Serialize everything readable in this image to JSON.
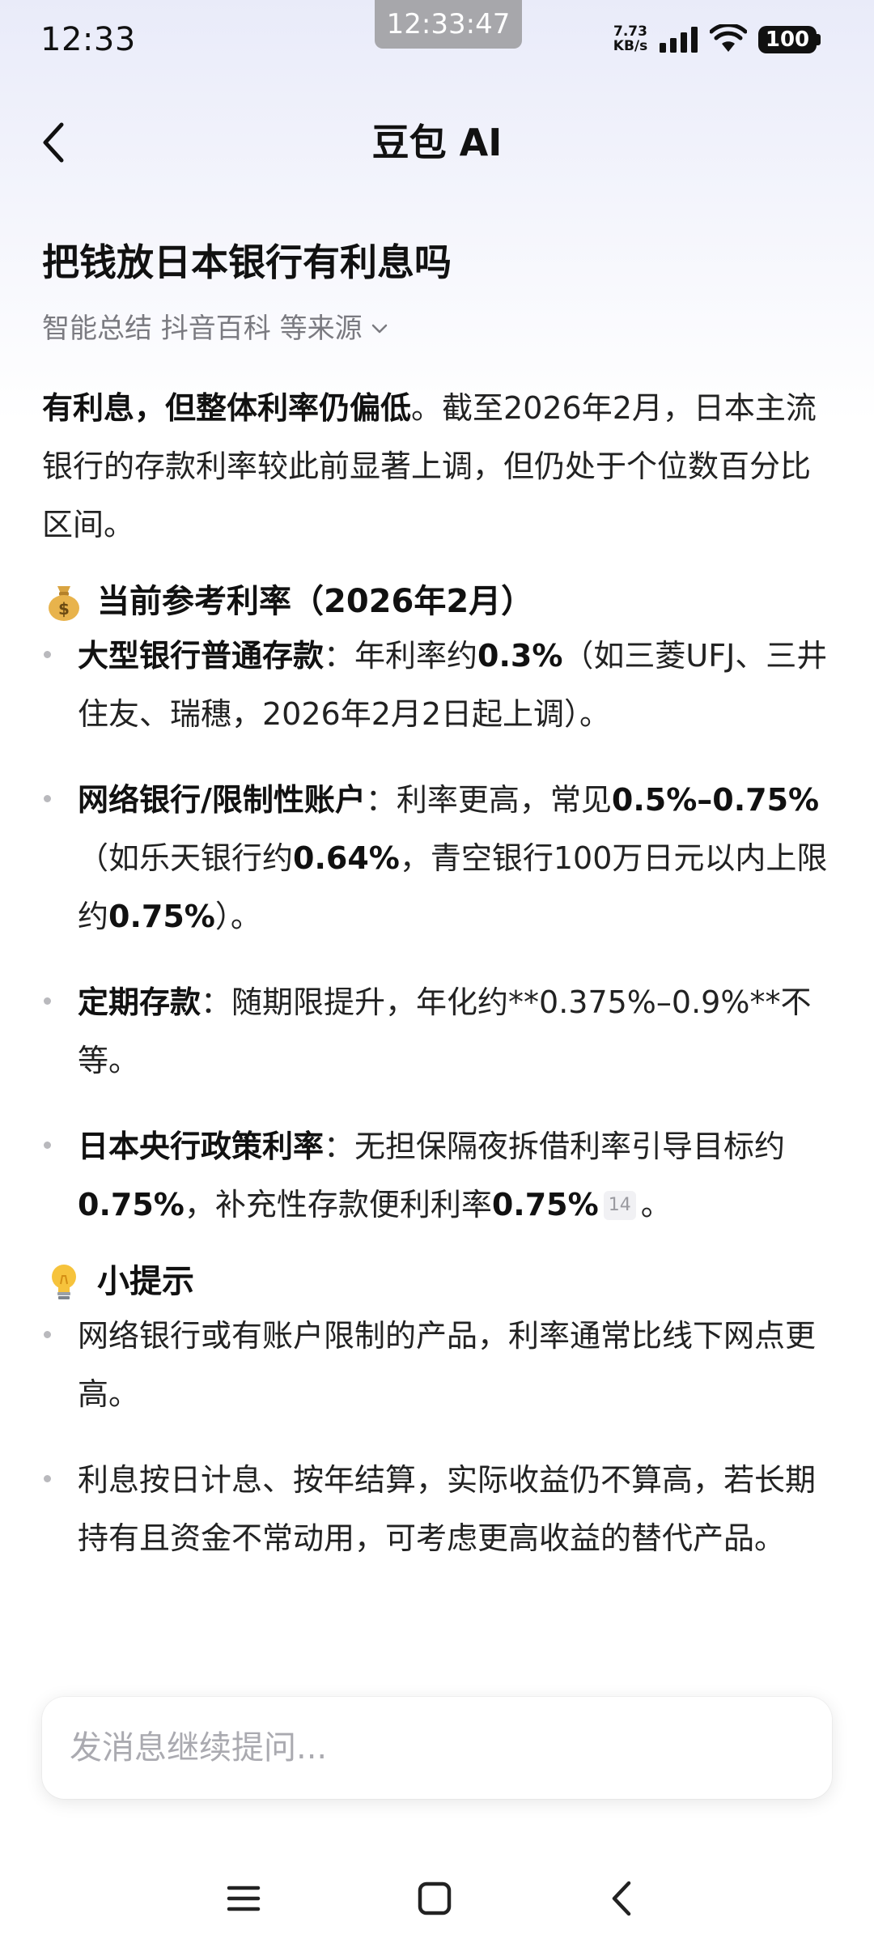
{
  "status_bar": {
    "time": "12:33",
    "screenshot_time": "12:33:47",
    "net_speed_value": "7.73",
    "net_speed_unit": "KB/s",
    "battery": "100"
  },
  "header": {
    "title": "豆包 AI"
  },
  "question": {
    "title": "把钱放日本银行有利息吗",
    "sources": "智能总结 抖音百科 等来源"
  },
  "intro": {
    "bold": "有利息，但整体利率仍偏低",
    "rest": "。截至2026年2月，日本主流银行的存款利率较此前显著上调，但仍处于个位数百分比区间。"
  },
  "section_rates": {
    "emoji": "money-bag",
    "heading": "当前参考利率（2026年2月）",
    "items": [
      {
        "label": "大型银行普通存款",
        "t1": "：年利率约",
        "b1": "0.3%",
        "t2": "（如三菱UFJ、三井住友、瑞穗，2026年2月2日起上调）。"
      },
      {
        "label": "网络银行/限制性账户",
        "t1": "：利率更高，常见",
        "b1": "0.5%–0.75%",
        "t2": "（如乐天银行约",
        "b2": "0.64%",
        "t3": "，青空银行100万日元以内上限约",
        "b3": "0.75%",
        "t4": "）。"
      },
      {
        "label": "定期存款",
        "t1": "：随期限提升，年化约**0.375%–0.9%**不等。"
      },
      {
        "label": "日本央行政策利率",
        "t1": "：无担保隔夜拆借利率引导目标约",
        "b1": "0.75%",
        "t2": "，补充性存款便利利率",
        "b2": "0.75%",
        "ref": "14",
        "t3": "。"
      }
    ]
  },
  "section_tips": {
    "emoji": "light-bulb",
    "heading": "小提示",
    "items": [
      "网络银行或有账户限制的产品，利率通常比线下网点更高。",
      "利息按日计息、按年结算，实际收益仍不算高，若长期持有且资金不常动用，可考虑更高收益的替代产品。"
    ]
  },
  "input": {
    "placeholder": "发消息继续提问..."
  },
  "icons": {
    "back": "chevron-left-icon",
    "sources_toggle": "chevron-down-icon",
    "nav_menu": "menu-icon",
    "nav_home": "home-square-icon",
    "nav_back": "back-icon"
  }
}
